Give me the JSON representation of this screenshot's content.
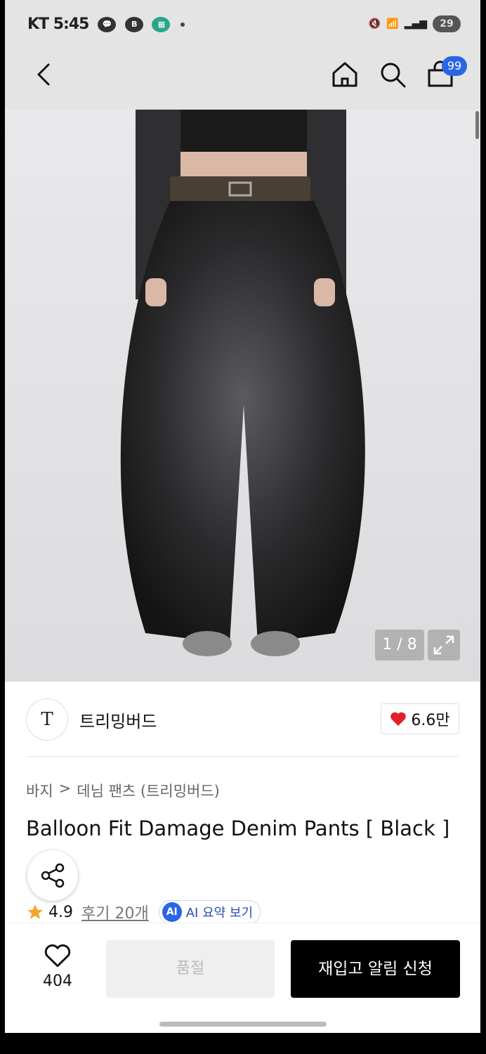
{
  "status_bar": {
    "carrier_time": "KT 5:45",
    "battery": "29"
  },
  "header": {
    "cart_badge": "99"
  },
  "gallery": {
    "counter": "1 / 8"
  },
  "brand": {
    "logo_letter": "T",
    "name": "트리밍버드",
    "likes": "6.6만"
  },
  "breadcrumb": {
    "category": "바지",
    "separator": ">",
    "subcategory": "데님 팬츠 (트리밍버드)"
  },
  "product": {
    "title": "Balloon Fit Damage Denim Pants [ Black ]",
    "rating": "4.9",
    "reviews": "후기 20개",
    "ai_badge": "AI",
    "ai_summary": "AI 요약 보기"
  },
  "bottom_bar": {
    "wish_count": "404",
    "soldout_label": "품절",
    "restock_label": "재입고 알림 신청"
  },
  "colors": {
    "accent_blue": "#2a65e8",
    "heart_red": "#e0202a",
    "star": "#f5a623"
  }
}
